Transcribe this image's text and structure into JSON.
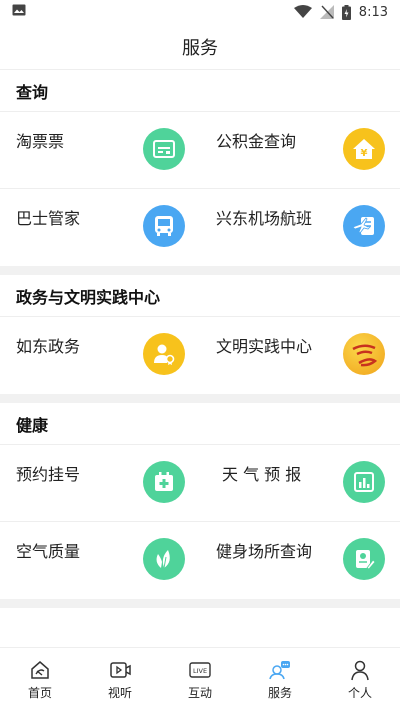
{
  "status_bar": {
    "time": "8:13",
    "icons": [
      "image-icon",
      "wifi-icon",
      "signal-icon",
      "battery-charging-icon"
    ]
  },
  "header": {
    "title": "服务"
  },
  "sections": [
    {
      "title": "查询",
      "items": [
        {
          "label": "淘票票",
          "icon": "ticket-icon",
          "color": "#4fd39a"
        },
        {
          "label": "公积金查询",
          "icon": "housing-fund-icon",
          "color": "#f7c21c"
        },
        {
          "label": "巴士管家",
          "icon": "bus-icon",
          "color": "#4aa7f2"
        },
        {
          "label": "兴东机场航班",
          "icon": "flight-icon",
          "color": "#4aa7f2"
        }
      ]
    },
    {
      "title": "政务与文明实践中心",
      "items": [
        {
          "label": "如东政务",
          "icon": "government-icon",
          "color": "#f7c21c"
        },
        {
          "label": "文明实践中心",
          "icon": "civilization-logo-icon",
          "color": "#f7a21c"
        }
      ]
    },
    {
      "title": "健康",
      "items": [
        {
          "label": "预约挂号",
          "icon": "medical-kit-icon",
          "color": "#4fd39a"
        },
        {
          "label": "天 气 预 报",
          "icon": "weather-chart-icon",
          "color": "#4fd39a"
        },
        {
          "label": "空气质量",
          "icon": "leaf-icon",
          "color": "#4fd39a"
        },
        {
          "label": "健身场所查询",
          "icon": "fitness-doc-icon",
          "color": "#4fd39a"
        }
      ]
    }
  ],
  "bottom_nav": [
    {
      "label": "首页",
      "icon": "home-icon"
    },
    {
      "label": "视听",
      "icon": "video-icon"
    },
    {
      "label": "互动",
      "icon": "live-icon"
    },
    {
      "label": "服务",
      "icon": "service-icon",
      "active": true
    },
    {
      "label": "个人",
      "icon": "person-icon"
    }
  ]
}
